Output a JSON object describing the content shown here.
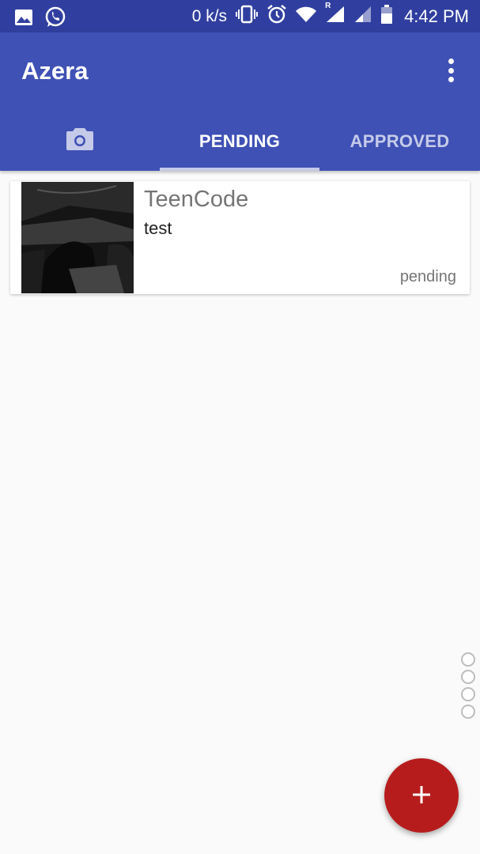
{
  "status_bar": {
    "net_speed": "0 k/s",
    "time": "4:42 PM",
    "left_icons": [
      "image-icon",
      "whatsapp-icon"
    ],
    "right_icons": [
      "vibrate-icon",
      "alarm-icon",
      "wifi-icon",
      "signal-icon",
      "signal-icon",
      "battery-icon"
    ],
    "roaming_badge": "R"
  },
  "app_bar": {
    "title": "Azera",
    "menu_icon": "more-vert-icon"
  },
  "tabs": [
    {
      "label": "",
      "icon": "camera-icon",
      "selected": false
    },
    {
      "label": "PENDING",
      "selected": true
    },
    {
      "label": "APPROVED",
      "selected": false
    }
  ],
  "items": [
    {
      "title": "TeenCode",
      "subtitle": "test",
      "status": "pending",
      "thumbnail": "photo-thumbnail"
    }
  ],
  "side_dots_count": 4,
  "fab": {
    "icon": "plus-icon"
  },
  "colors": {
    "status_bar": "#303f9f",
    "primary": "#3f51b5",
    "tab_indicator": "#c5cae9",
    "fab": "#b71c1c",
    "background": "#fafafa"
  }
}
